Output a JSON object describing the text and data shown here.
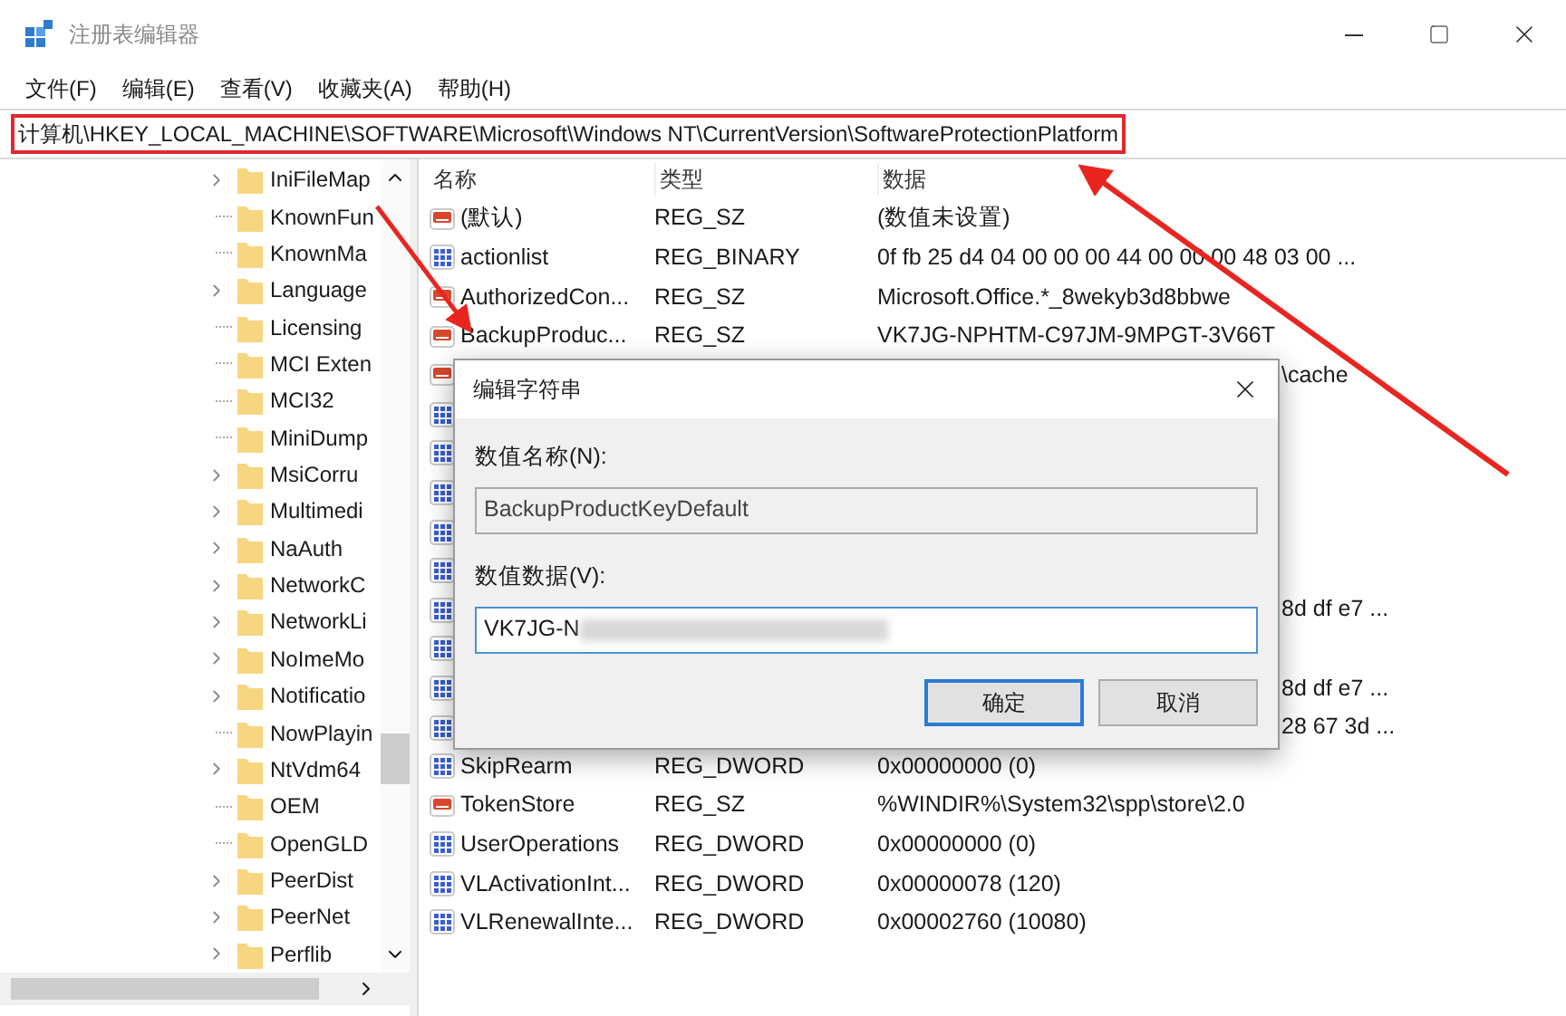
{
  "window": {
    "title": "注册表编辑器"
  },
  "menu": [
    "文件(F)",
    "编辑(E)",
    "查看(V)",
    "收藏夹(A)",
    "帮助(H)"
  ],
  "address_bar": {
    "path": "计算机\\HKEY_LOCAL_MACHINE\\SOFTWARE\\Microsoft\\Windows NT\\CurrentVersion\\SoftwareProtectionPlatform",
    "highlighted": true
  },
  "tree": {
    "items": [
      {
        "label": "IniFileMap",
        "expandable": true
      },
      {
        "label": "KnownFun",
        "expandable": false
      },
      {
        "label": "KnownMa",
        "expandable": false
      },
      {
        "label": "Language",
        "expandable": true
      },
      {
        "label": "Licensing",
        "expandable": false
      },
      {
        "label": "MCI Exten",
        "expandable": false
      },
      {
        "label": "MCI32",
        "expandable": false
      },
      {
        "label": "MiniDump",
        "expandable": false
      },
      {
        "label": "MsiCorru",
        "expandable": true
      },
      {
        "label": "Multimedi",
        "expandable": true
      },
      {
        "label": "NaAuth",
        "expandable": true
      },
      {
        "label": "NetworkC",
        "expandable": true
      },
      {
        "label": "NetworkLi",
        "expandable": true
      },
      {
        "label": "NoImeMo",
        "expandable": true
      },
      {
        "label": "Notificatio",
        "expandable": true
      },
      {
        "label": "NowPlayin",
        "expandable": false
      },
      {
        "label": "NtVdm64",
        "expandable": true
      },
      {
        "label": "OEM",
        "expandable": false
      },
      {
        "label": "OpenGLD",
        "expandable": false
      },
      {
        "label": "PeerDist",
        "expandable": true
      },
      {
        "label": "PeerNet",
        "expandable": true
      },
      {
        "label": "Perflib",
        "expandable": true
      }
    ]
  },
  "list": {
    "columns": [
      "名称",
      "类型",
      "数据"
    ],
    "rows": [
      {
        "kind": "string",
        "name": "(默认)",
        "type": "REG_SZ",
        "data": "(数值未设置)"
      },
      {
        "kind": "binary",
        "name": "actionlist",
        "type": "REG_BINARY",
        "data": "0f fb 25 d4 04 00 00 00 44 00 00 00 48 03 00 ..."
      },
      {
        "kind": "string",
        "name": "AuthorizedCon...",
        "type": "REG_SZ",
        "data": "Microsoft.Office.*_8wekyb3d8bbwe"
      },
      {
        "kind": "string",
        "name": "BackupProduc...",
        "type": "REG_SZ",
        "data": "VK7JG-NPHTM-C97JM-9MPGT-3V66T"
      },
      {
        "kind": "string",
        "data": "\\cache"
      },
      {
        "kind": "binary"
      },
      {
        "kind": "binary"
      },
      {
        "kind": "binary"
      },
      {
        "kind": "binary"
      },
      {
        "kind": "binary"
      },
      {
        "kind": "binary",
        "data": "8d df e7 ..."
      },
      {
        "kind": "binary"
      },
      {
        "kind": "binary",
        "data": "8d df e7 ..."
      },
      {
        "kind": "binary",
        "data": "28 67 3d ..."
      },
      {
        "kind": "binary",
        "name": "SkipRearm",
        "type": "REG_DWORD",
        "data": "0x00000000 (0)"
      },
      {
        "kind": "string",
        "name": "TokenStore",
        "type": "REG_SZ",
        "data": "%WINDIR%\\System32\\spp\\store\\2.0"
      },
      {
        "kind": "binary",
        "name": "UserOperations",
        "type": "REG_DWORD",
        "data": "0x00000000 (0)"
      },
      {
        "kind": "binary",
        "name": "VLActivationInt...",
        "type": "REG_DWORD",
        "data": "0x00000078 (120)"
      },
      {
        "kind": "binary",
        "name": "VLRenewalInte...",
        "type": "REG_DWORD",
        "data": "0x00002760 (10080)"
      }
    ]
  },
  "dialog": {
    "title": "编辑字符串",
    "name_label": "数值名称(N):",
    "name_value": "BackupProductKeyDefault",
    "data_label": "数值数据(V):",
    "data_value": "VK7JG-N",
    "data_blurred": true,
    "buttons": [
      {
        "label": "确定",
        "default": true
      },
      {
        "label": "取消",
        "default": false
      }
    ]
  }
}
